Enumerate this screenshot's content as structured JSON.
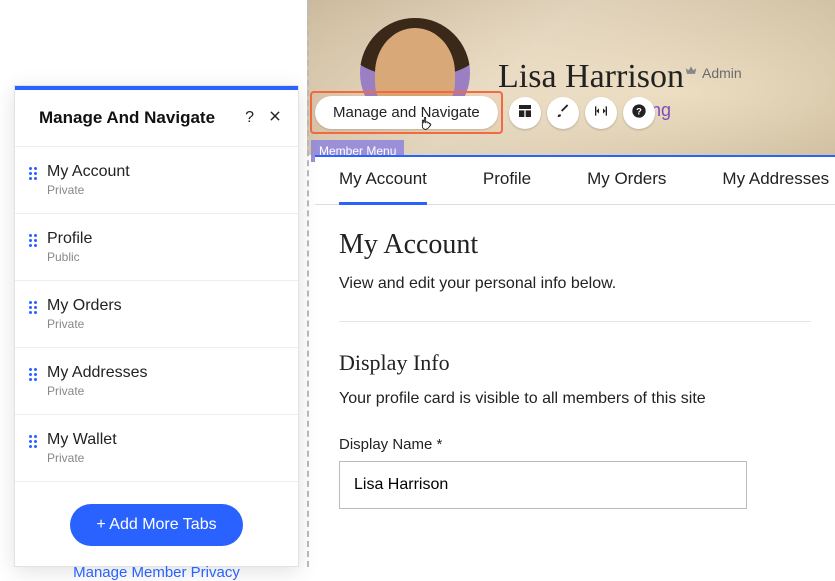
{
  "header": {
    "member_name": "Lisa Harrison",
    "admin_label": "Admin",
    "following_text": "owing"
  },
  "toolbar": {
    "manage_navigate_label": "Manage and Navigate",
    "member_menu_tag": "Member Menu"
  },
  "tabs": [
    {
      "label": "My Account",
      "active": true
    },
    {
      "label": "Profile",
      "active": false
    },
    {
      "label": "My Orders",
      "active": false
    },
    {
      "label": "My Addresses",
      "active": false
    }
  ],
  "content": {
    "heading": "My Account",
    "subtext": "View and edit your personal info below.",
    "section_heading": "Display Info",
    "section_info": "Your profile card is visible to all members of this site",
    "display_name_label": "Display Name *",
    "display_name_value": "Lisa Harrison"
  },
  "panel": {
    "title": "Manage And Navigate",
    "help_label": "?",
    "items": [
      {
        "label": "My Account",
        "privacy": "Private"
      },
      {
        "label": "Profile",
        "privacy": "Public"
      },
      {
        "label": "My Orders",
        "privacy": "Private"
      },
      {
        "label": "My Addresses",
        "privacy": "Private"
      },
      {
        "label": "My Wallet",
        "privacy": "Private"
      }
    ],
    "add_more_label": "+  Add More Tabs",
    "privacy_link": "Manage Member Privacy"
  }
}
